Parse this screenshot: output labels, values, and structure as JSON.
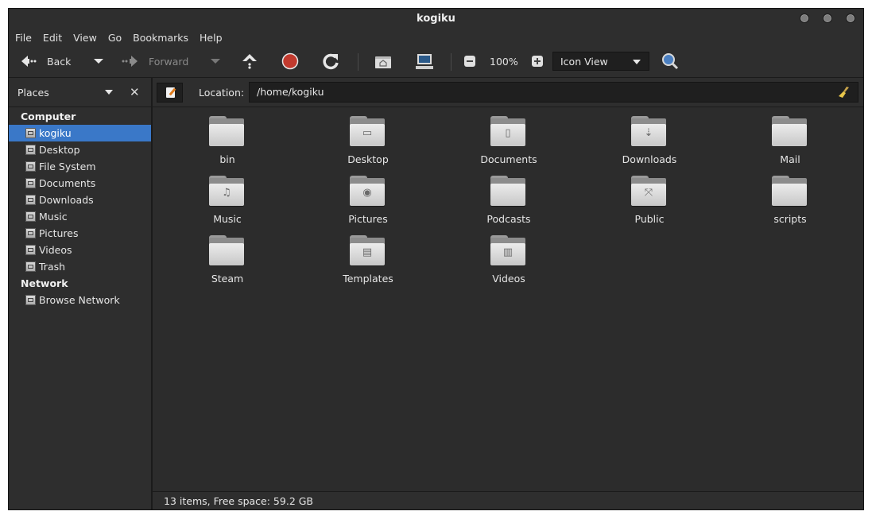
{
  "window": {
    "title": "kogiku"
  },
  "menu": [
    "File",
    "Edit",
    "View",
    "Go",
    "Bookmarks",
    "Help"
  ],
  "toolbar": {
    "back": "Back",
    "forward": "Forward",
    "zoom": "100%",
    "view_mode": "Icon View"
  },
  "sidebar": {
    "header": "Places",
    "sections": [
      {
        "title": "Computer",
        "items": [
          {
            "label": "kogiku",
            "icon": "home-icon",
            "selected": true
          },
          {
            "label": "Desktop",
            "icon": "desktop-icon"
          },
          {
            "label": "File System",
            "icon": "filesystem-icon"
          },
          {
            "label": "Documents",
            "icon": "documents-icon"
          },
          {
            "label": "Downloads",
            "icon": "downloads-icon"
          },
          {
            "label": "Music",
            "icon": "music-icon"
          },
          {
            "label": "Pictures",
            "icon": "pictures-icon"
          },
          {
            "label": "Videos",
            "icon": "videos-icon"
          },
          {
            "label": "Trash",
            "icon": "trash-icon"
          }
        ]
      },
      {
        "title": "Network",
        "items": [
          {
            "label": "Browse Network",
            "icon": "network-icon"
          }
        ]
      }
    ]
  },
  "location": {
    "label": "Location:",
    "path": "/home/kogiku"
  },
  "files": [
    {
      "name": "bin",
      "emblem": ""
    },
    {
      "name": "Desktop",
      "emblem": "▭"
    },
    {
      "name": "Documents",
      "emblem": "▯"
    },
    {
      "name": "Downloads",
      "emblem": "⇣"
    },
    {
      "name": "Mail",
      "emblem": ""
    },
    {
      "name": "Music",
      "emblem": "♫"
    },
    {
      "name": "Pictures",
      "emblem": "◉"
    },
    {
      "name": "Podcasts",
      "emblem": ""
    },
    {
      "name": "Public",
      "emblem": "⤧"
    },
    {
      "name": "scripts",
      "emblem": ""
    },
    {
      "name": "Steam",
      "emblem": ""
    },
    {
      "name": "Templates",
      "emblem": "▤"
    },
    {
      "name": "Videos",
      "emblem": "▥"
    }
  ],
  "status": "13 items, Free space: 59.2 GB",
  "colors": {
    "background": "#2e2e2e",
    "selection": "#3a78c8",
    "text": "#e6e6e6"
  }
}
